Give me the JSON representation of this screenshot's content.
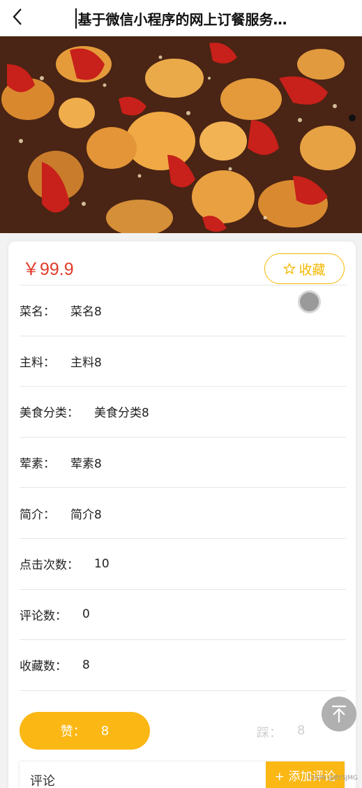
{
  "header": {
    "title": "基于微信小程序的网上订餐服务…"
  },
  "dish": {
    "price": "￥99.9",
    "favorite_label": "收藏",
    "fields": [
      {
        "label": "菜名：",
        "value": "菜名8"
      },
      {
        "label": "主料：",
        "value": "主料8"
      },
      {
        "label": "美食分类：",
        "value": "美食分类8"
      },
      {
        "label": "荤素：",
        "value": "荤素8"
      },
      {
        "label": "简介：",
        "value": "简介8"
      },
      {
        "label": "点击次数：",
        "value": "10"
      },
      {
        "label": "评论数：",
        "value": "0"
      },
      {
        "label": "收藏数：",
        "value": "8"
      }
    ]
  },
  "actions": {
    "like_label": "赞：",
    "like_count": "8",
    "dislike_label": "踩：",
    "dislike_count": "8"
  },
  "comments": {
    "label": "评论",
    "add_label": "+ 添加评论"
  },
  "watermark": "CSDN @BYSJMG",
  "icons": {
    "back": "back-arrow-icon",
    "favorite": "star-outline-icon",
    "to_top": "back-to-top-icon"
  },
  "colors": {
    "accent": "#fbb714",
    "price": "#e23b2a",
    "favorite": "#f5b800"
  }
}
